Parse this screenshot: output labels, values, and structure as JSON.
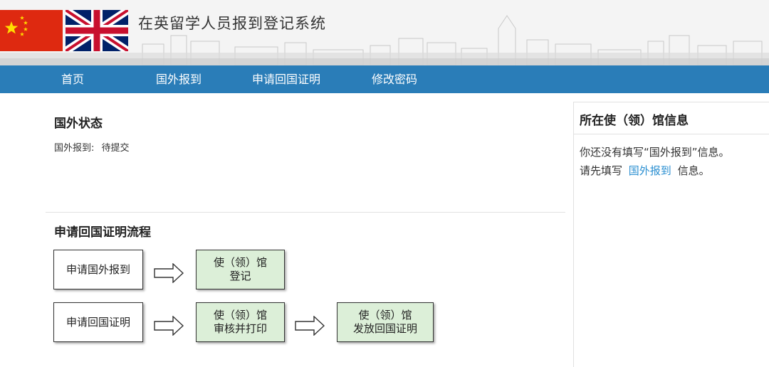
{
  "header": {
    "site_title": "在英留学人员报到登记系统"
  },
  "nav": {
    "items": [
      {
        "label": "首页"
      },
      {
        "label": "国外报到"
      },
      {
        "label": "申请回国证明"
      },
      {
        "label": "修改密码"
      }
    ]
  },
  "status": {
    "title": "国外状态",
    "label": "国外报到:",
    "value": "待提交"
  },
  "process": {
    "title": "申请回国证明流程",
    "row1": {
      "step1": "申请国外报到",
      "step2_line1": "使（领）馆",
      "step2_line2": "登记"
    },
    "row2": {
      "step1": "申请回国证明",
      "step2_line1": "使（领）馆",
      "step2_line2": "审核并打印",
      "step3_line1": "使（领）馆",
      "step3_line2": "发放回国证明"
    }
  },
  "sidebar": {
    "title": "所在使（领）馆信息",
    "message1": "你还没有填写“国外报到”信息。",
    "message2_prefix": "请先填写",
    "message2_link": "国外报到",
    "message2_suffix": "信息。"
  },
  "colors": {
    "nav_bg": "#2a7db8",
    "green_box": "#dcefd8",
    "link": "#2a8fd1"
  }
}
